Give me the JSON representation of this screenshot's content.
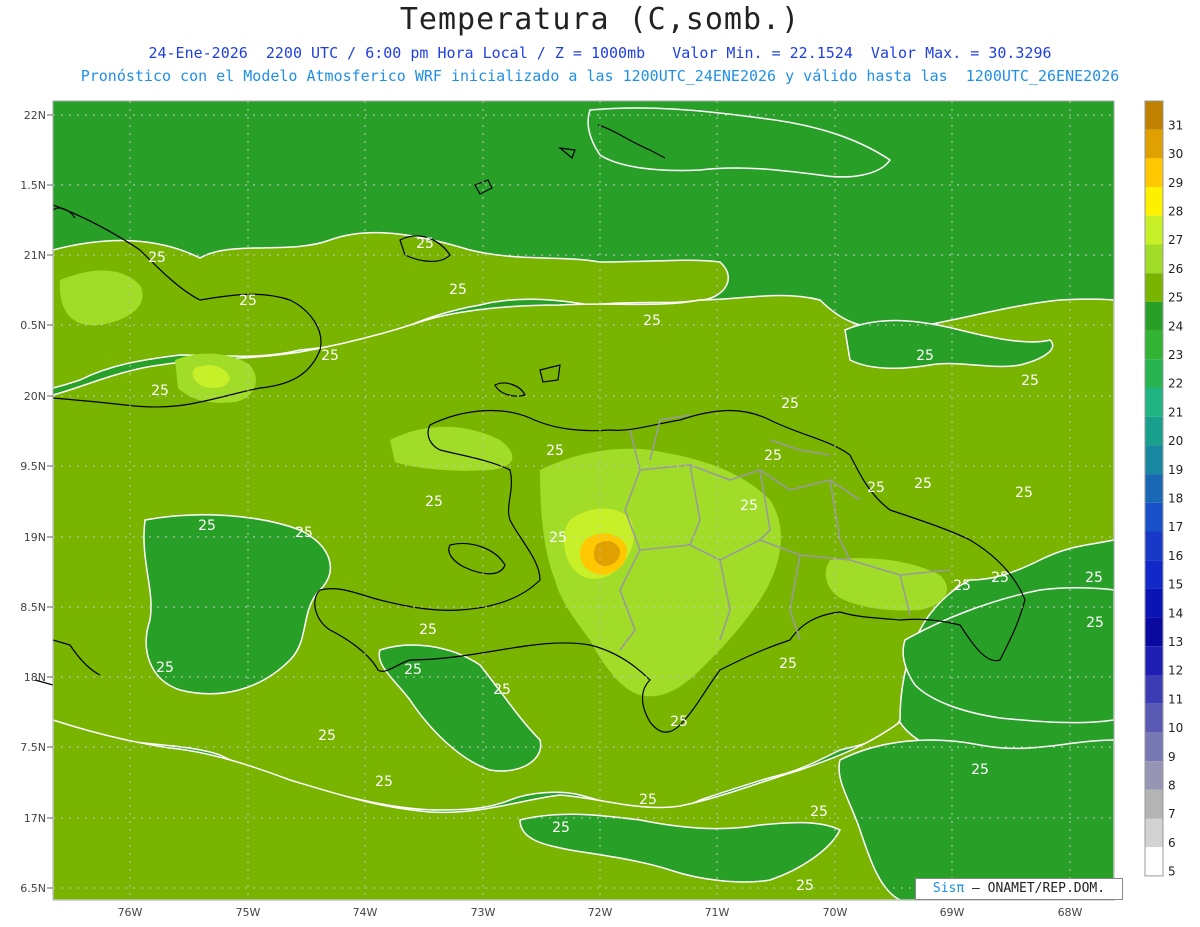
{
  "header": {
    "title": "Temperatura (C,somb.)",
    "line1": "24-Ene-2026  2200 UTC / 6:00 pm Hora Local / Z = 1000mb   Valor Min. = 22.1524  Valor Max. = 30.3296",
    "line2": "Pronóstico con el Modelo Atmosferico WRF inicializado a las 1200UTC_24ENE2026 y válido hasta las  1200UTC_26ENE2026"
  },
  "lat_labels": [
    "22N",
    "1.5N",
    "21N",
    "0.5N",
    "20N",
    "9.5N",
    "19N",
    "8.5N",
    "18N",
    "7.5N",
    "17N",
    "6.5N"
  ],
  "lon_labels": [
    "76W",
    "75W",
    "74W",
    "73W",
    "72W",
    "71W",
    "70W",
    "69W",
    "68W"
  ],
  "contour_labels": [
    "25",
    "25",
    "25",
    "25",
    "25",
    "25",
    "25",
    "25",
    "25",
    "25",
    "25",
    "25",
    "25",
    "25",
    "25",
    "25",
    "25",
    "25",
    "25",
    "25",
    "25",
    "25",
    "25",
    "25",
    "25",
    "25",
    "25",
    "25"
  ],
  "colorbar": {
    "labels": [
      "31",
      "30",
      "29",
      "28",
      "27",
      "26",
      "25",
      "24",
      "23",
      "22",
      "21",
      "20",
      "19",
      "18",
      "17",
      "16",
      "15",
      "14",
      "13",
      "12",
      "11",
      "10",
      "9",
      "8",
      "7",
      "6",
      "5"
    ],
    "colors": [
      "#c08000",
      "#e0a000",
      "#ffc800",
      "#fff000",
      "#c8f028",
      "#a0dc28",
      "#78b400",
      "#28a028",
      "#32b432",
      "#28b450",
      "#20b482",
      "#18a08c",
      "#1888a0",
      "#1868b4",
      "#1850c8",
      "#1838c8",
      "#1028c8",
      "#0a14b4",
      "#0a0aa0",
      "#1e1eb4",
      "#3c3cb4",
      "#5a5ab4",
      "#7878b4",
      "#9696b4",
      "#b4b4b4",
      "#d2d2d2",
      "#ffffff"
    ]
  },
  "credit": {
    "sis": "Sisπ",
    "rest": "– ONAMET/REP.DOM."
  }
}
